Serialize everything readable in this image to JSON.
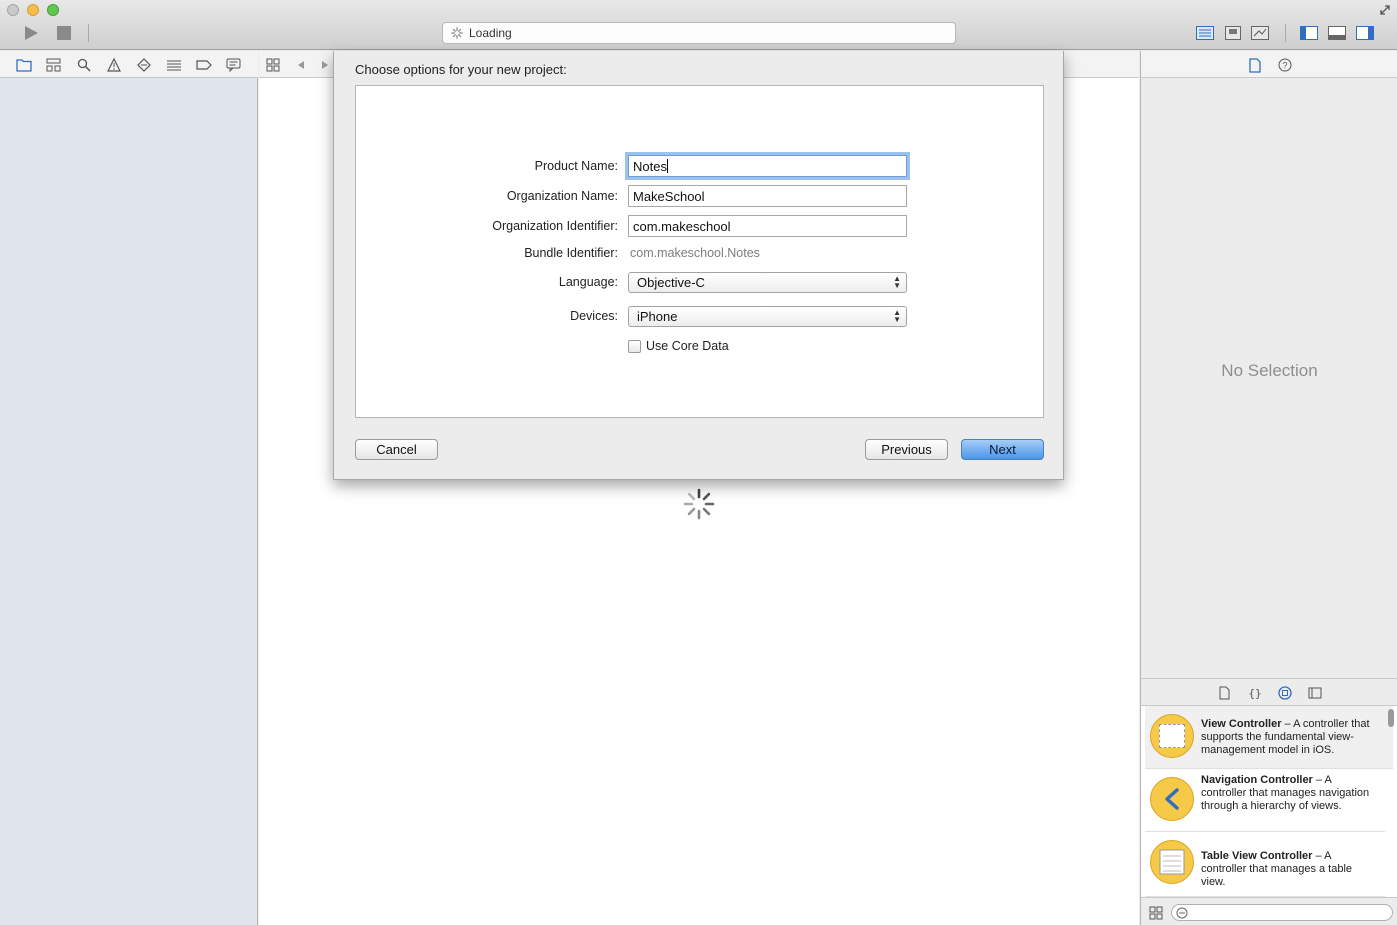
{
  "window": {
    "activity_text": "Loading"
  },
  "sheet": {
    "title": "Choose options for your new project:",
    "fields": {
      "product_name_label": "Product Name:",
      "product_name_value": "Notes",
      "org_name_label": "Organization Name:",
      "org_name_value": "MakeSchool",
      "org_id_label": "Organization Identifier:",
      "org_id_value": "com.makeschool",
      "bundle_id_label": "Bundle Identifier:",
      "bundle_id_value": "com.makeschool.Notes",
      "language_label": "Language:",
      "language_value": "Objective-C",
      "devices_label": "Devices:",
      "devices_value": "iPhone",
      "core_data_label": "Use Core Data",
      "core_data_checked": false
    },
    "buttons": {
      "cancel": "Cancel",
      "previous": "Previous",
      "next": "Next"
    }
  },
  "inspector": {
    "empty_text": "No Selection"
  },
  "library": {
    "items": [
      {
        "title": "View Controller",
        "desc": " – A controller that supports the fundamental view-management model in iOS."
      },
      {
        "title": "Navigation Controller",
        "desc": " – A controller that manages navigation through a hierarchy of views."
      },
      {
        "title": "Table View Controller",
        "desc": " – A controller that manages a table view."
      }
    ]
  },
  "colors": {
    "accent": "#4b95e8",
    "library_icon": "#f7c948",
    "navigator_bg": "#e1e6ec"
  }
}
